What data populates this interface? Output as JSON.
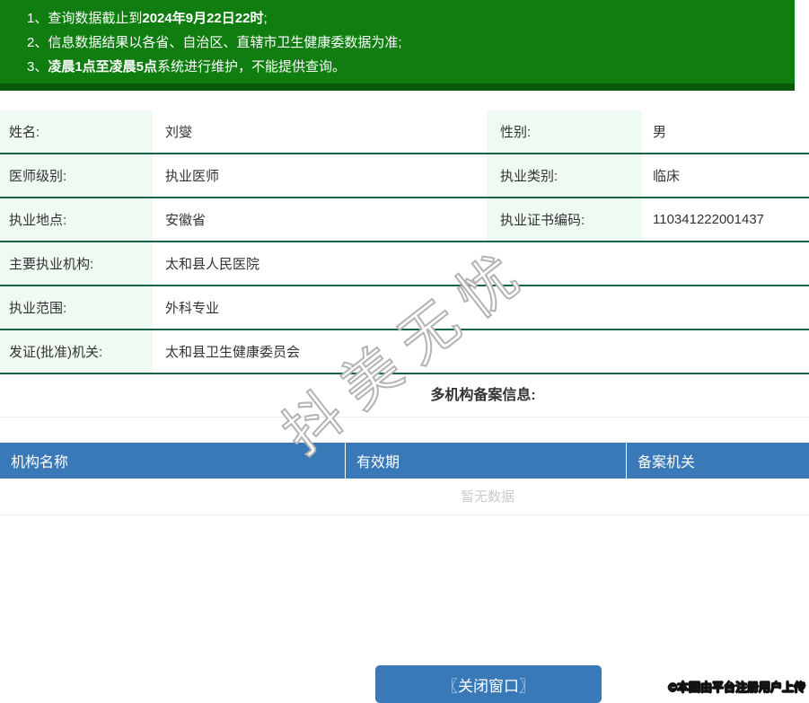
{
  "notice": {
    "items": [
      {
        "num": "1、",
        "pre": "查询数据截止到",
        "bold": "2024年9月22日22时",
        "post": ";"
      },
      {
        "num": "2、",
        "pre": "信息数据结果以各省、自治区、直辖市卫生健康委数据为准;",
        "bold": "",
        "post": ""
      },
      {
        "num": "3、",
        "pre": "",
        "bold": "凌晨1点至凌晨5点",
        "post": "系统进行维护，不能提供查询。"
      }
    ]
  },
  "info": {
    "rows": [
      {
        "label": "姓名:",
        "value": "刘燮",
        "label2": "性别:",
        "value2": "男"
      },
      {
        "label": "医师级别:",
        "value": "执业医师",
        "label2": "执业类别:",
        "value2": "临床"
      },
      {
        "label": "执业地点:",
        "value": "安徽省",
        "label2": "执业证书编码:",
        "value2": "110341222001437"
      },
      {
        "label": "主要执业机构:",
        "value": "太和县人民医院"
      },
      {
        "label": "执业范围:",
        "value": "外科专业"
      },
      {
        "label": "发证(批准)机关:",
        "value": "太和县卫生健康委员会"
      }
    ]
  },
  "records": {
    "heading": "多机构备案信息:",
    "columns": [
      "机构名称",
      "有效期",
      "备案机关"
    ],
    "empty_text": "暂无数据"
  },
  "footer": {
    "close_button": "〖关闭窗口〗",
    "copyright": "©本图由平台注册用户上传"
  },
  "watermark": "抖美无忧",
  "colors": {
    "banner_green": "#107d10",
    "banner_green_dark": "#085808",
    "header_blue": "#3a79b7",
    "row_border_green": "#156349",
    "label_bg": "#effaf3"
  }
}
